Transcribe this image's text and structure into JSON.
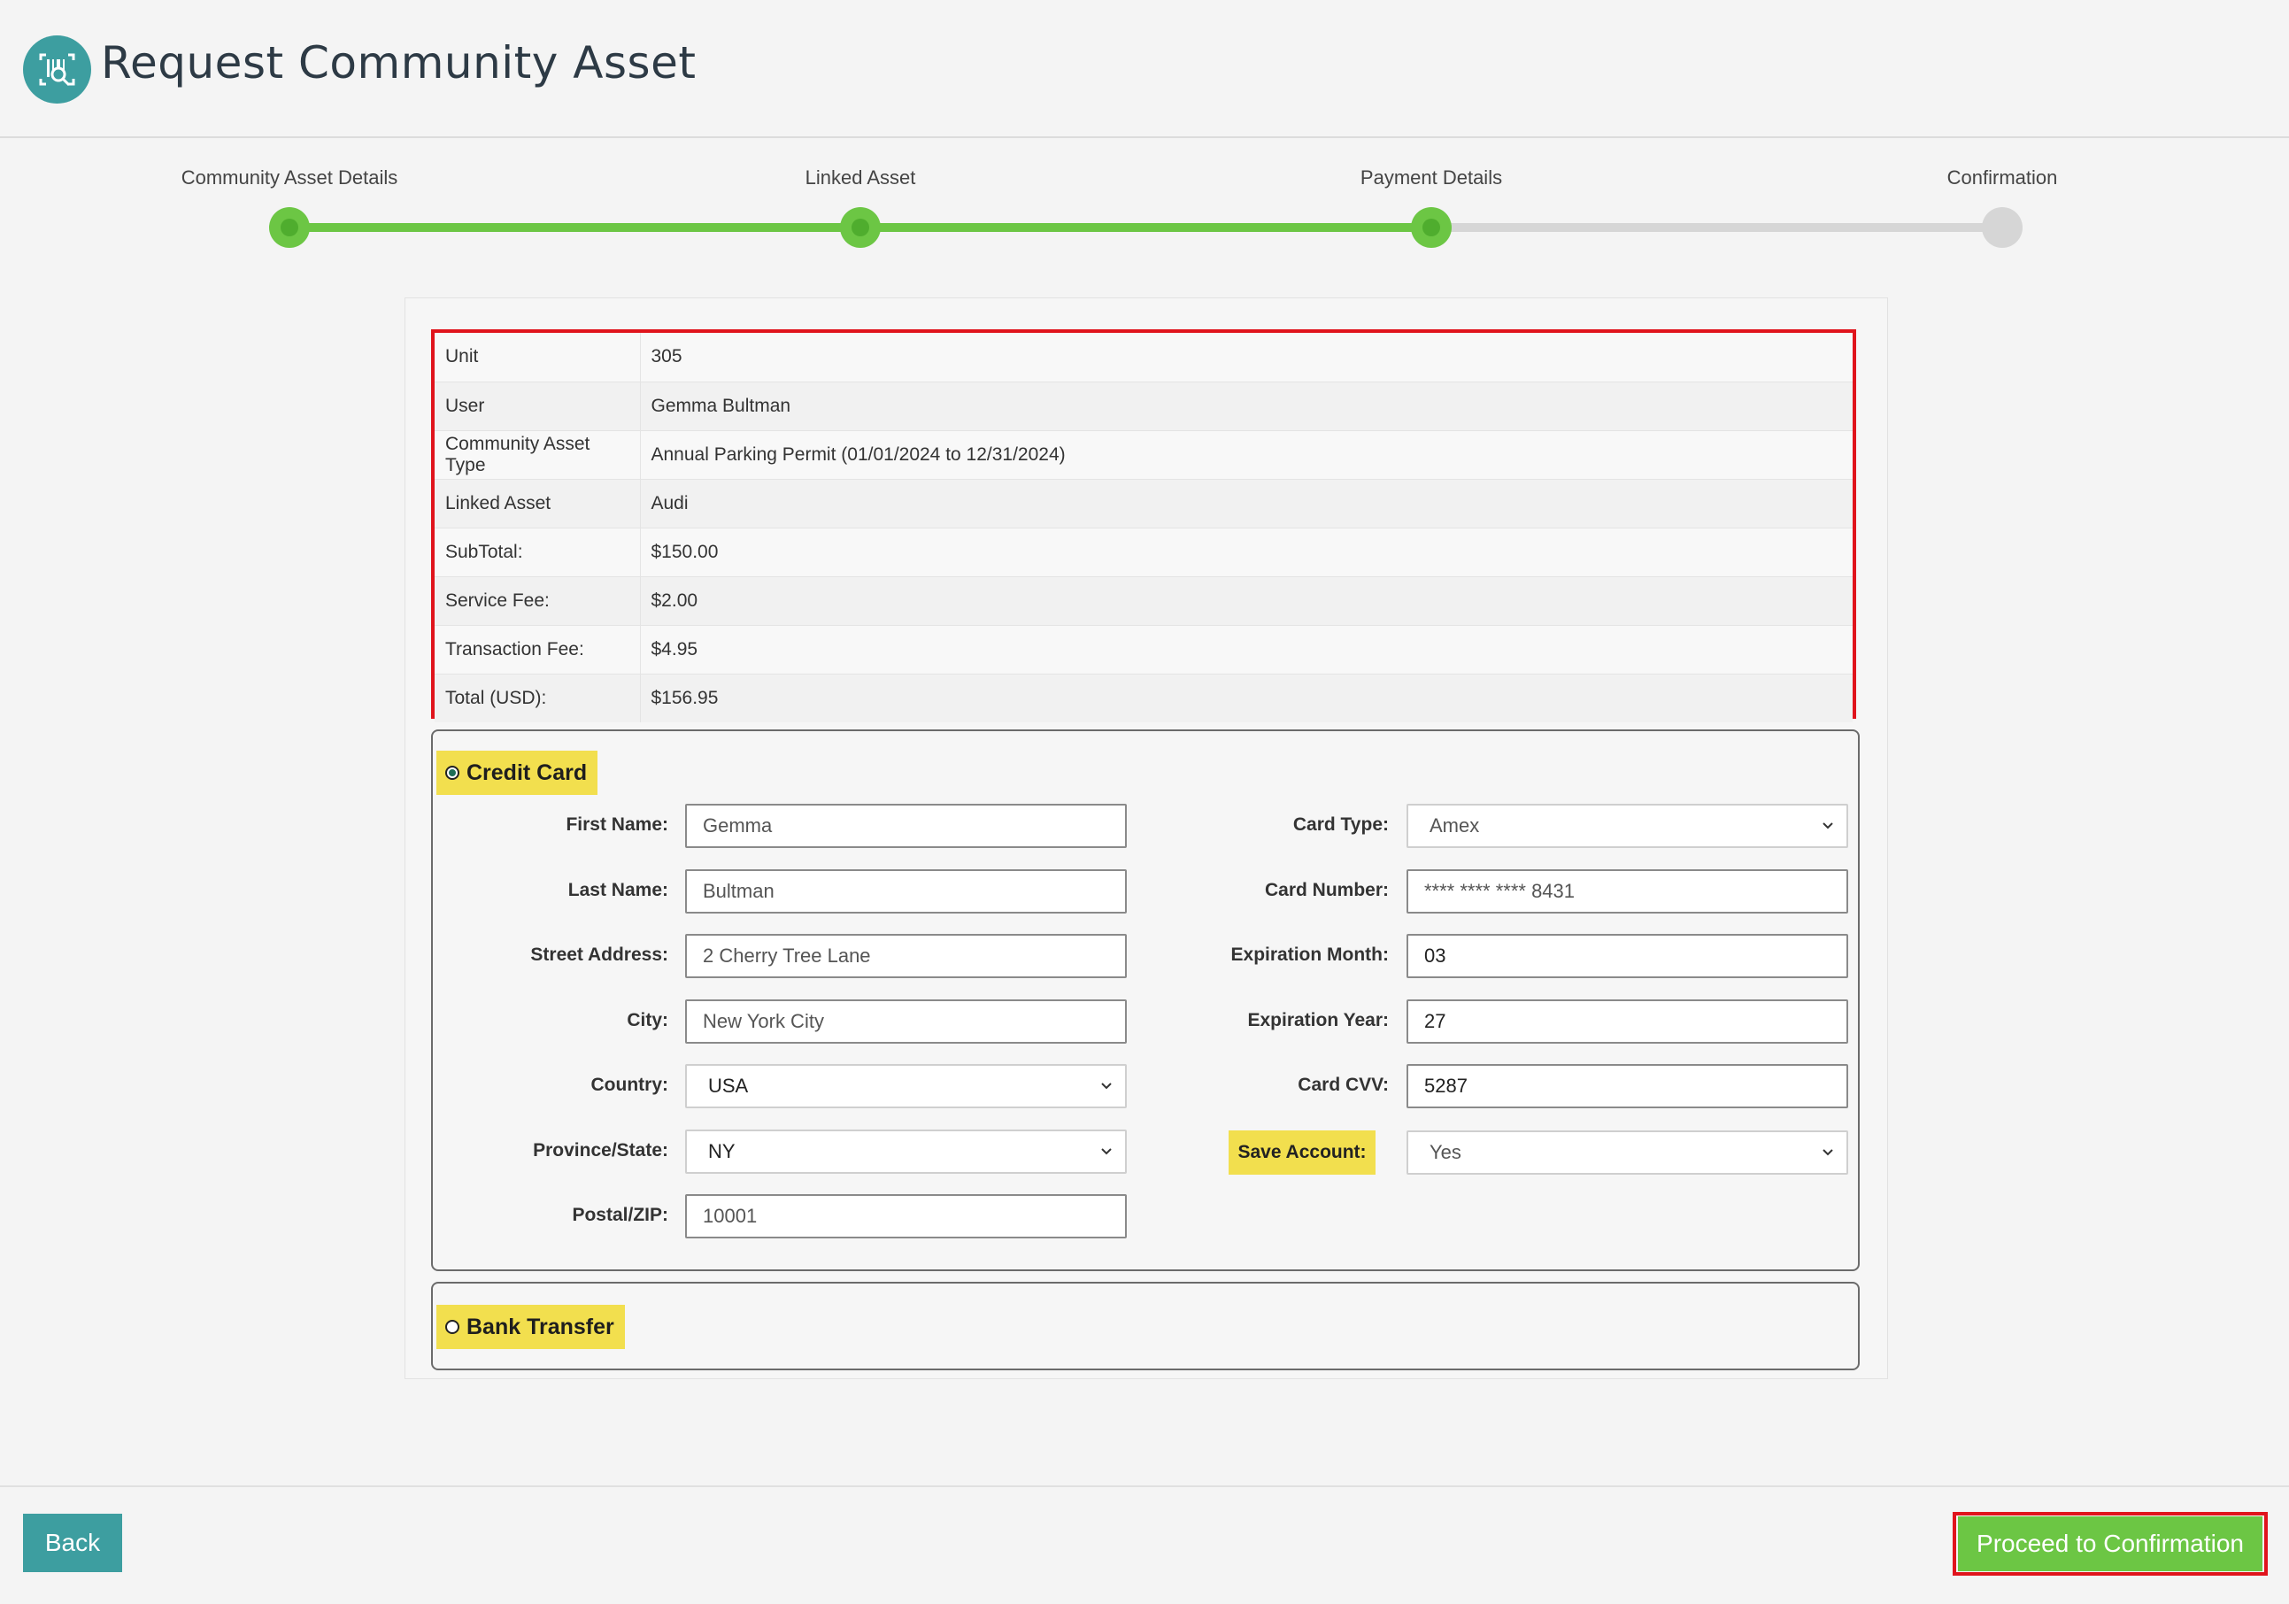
{
  "header": {
    "title": "Request Community Asset",
    "logo_icon": "barcode-scanner-icon"
  },
  "stepper": {
    "steps": [
      {
        "label": "Community Asset Details",
        "status": "complete"
      },
      {
        "label": "Linked Asset",
        "status": "complete"
      },
      {
        "label": "Payment Details",
        "status": "current"
      },
      {
        "label": "Confirmation",
        "status": "pending"
      }
    ]
  },
  "summary": {
    "rows": [
      {
        "label": "Unit",
        "value": "305"
      },
      {
        "label": "User",
        "value": "Gemma Bultman"
      },
      {
        "label": "Community Asset Type",
        "value": "Annual Parking Permit (01/01/2024 to 12/31/2024)"
      },
      {
        "label": "Linked Asset",
        "value": "Audi"
      },
      {
        "label": "SubTotal:",
        "value": "$150.00"
      },
      {
        "label": "Service Fee:",
        "value": "$2.00"
      },
      {
        "label": "Transaction Fee:",
        "value": "$4.95"
      },
      {
        "label": "Total (USD):",
        "value": "$156.95"
      }
    ]
  },
  "payment": {
    "credit_card": {
      "label": "Credit Card",
      "selected": true,
      "first_name": {
        "label": "First Name:",
        "value": "Gemma"
      },
      "last_name": {
        "label": "Last Name:",
        "value": "Bultman"
      },
      "street": {
        "label": "Street Address:",
        "value": "2 Cherry Tree Lane"
      },
      "city": {
        "label": "City:",
        "value": "New York City"
      },
      "country": {
        "label": "Country:",
        "value": "USA"
      },
      "province": {
        "label": "Province/State:",
        "value": "NY"
      },
      "postal": {
        "label": "Postal/ZIP:",
        "value": "10001"
      },
      "card_type": {
        "label": "Card Type:",
        "value": "Amex"
      },
      "card_number": {
        "label": "Card Number:",
        "value": "**** **** **** 8431"
      },
      "exp_month": {
        "label": "Expiration Month:",
        "value": "03"
      },
      "exp_year": {
        "label": "Expiration Year:",
        "value": "27"
      },
      "cvv": {
        "label": "Card CVV:",
        "value": "5287"
      },
      "save_account": {
        "label": "Save Account:",
        "value": "Yes"
      }
    },
    "bank_transfer": {
      "label": "Bank Transfer",
      "selected": false
    }
  },
  "footer": {
    "back_label": "Back",
    "proceed_label": "Proceed to Confirmation"
  },
  "colors": {
    "brand_teal": "#3d9ea0",
    "progress_green": "#6cc644",
    "highlight_yellow": "#f2df4e",
    "annotation_red": "#e0141c"
  }
}
